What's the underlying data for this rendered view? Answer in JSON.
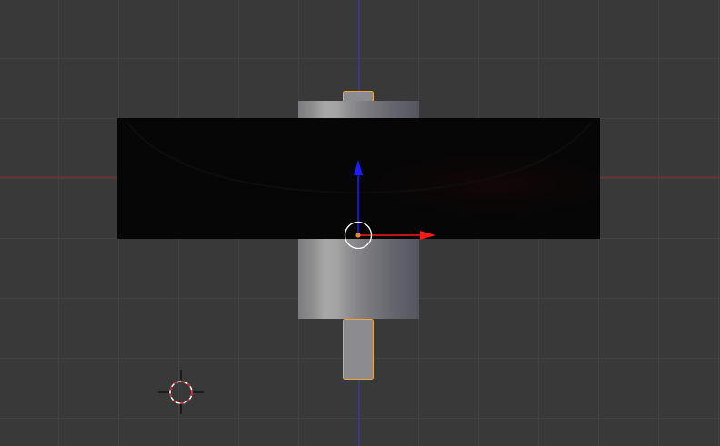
{
  "viewport": {
    "name": "3D Viewport",
    "view": "front-orthographic",
    "background_color": "#393939",
    "grid_line_color": "#434343",
    "x_axis_color": "#8a2d2d",
    "z_axis_color": "#3a3aa8"
  },
  "objects": [
    {
      "name": "selected-shaft",
      "type": "mesh",
      "selected": true,
      "outline_color": "#f3a43b"
    },
    {
      "name": "cylinder",
      "type": "mesh",
      "selected": false
    },
    {
      "name": "dark-plate",
      "type": "mesh",
      "selected": false,
      "color": "#060606"
    }
  ],
  "gizmo": {
    "type": "translate",
    "z_arrow_color": "#1d1dff",
    "x_arrow_color": "#ff1a1a",
    "pivot_color": "#e08a2c"
  },
  "cursor": {
    "name": "3d-cursor",
    "ring_colors": [
      "#ffffff",
      "#d11c1c"
    ]
  }
}
